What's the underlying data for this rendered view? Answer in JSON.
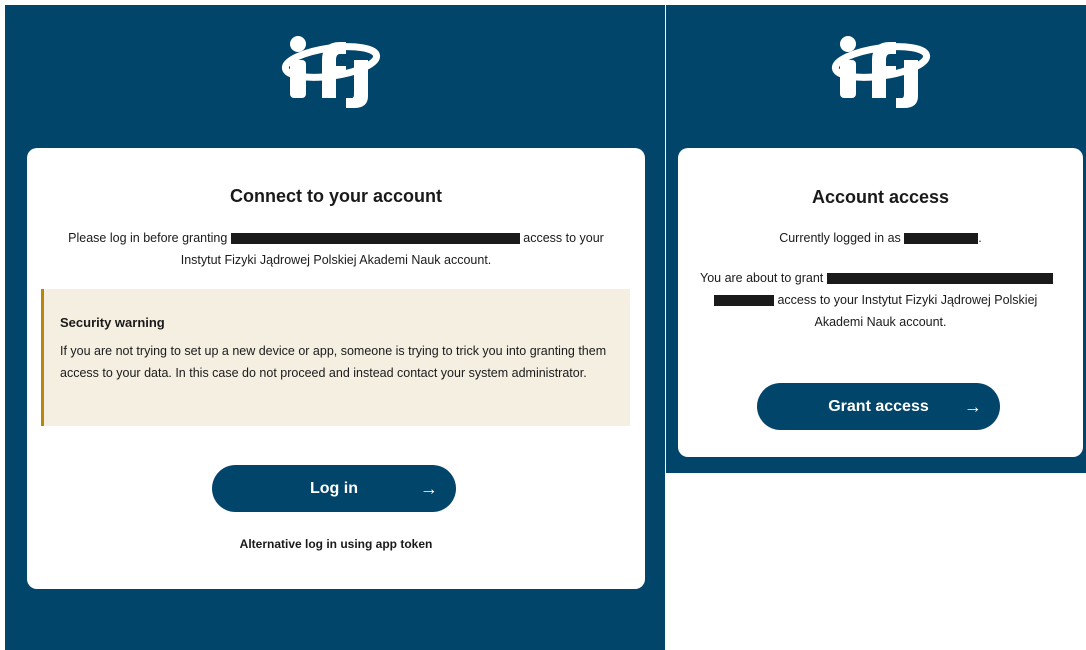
{
  "login": {
    "title": "Connect to your account",
    "intro_before": "Please log in before granting",
    "intro_after": "access to your",
    "intro_line2": "Instytut Fizyki Jądrowej Polskiej Akademi Nauk account.",
    "warning": {
      "title": "Security warning",
      "text": "If you are not trying to set up a new device or app, someone is trying to trick you into granting them access to your data. In this case do not proceed and instead contact your system administrator."
    },
    "login_button": "Log in",
    "alt_login": "Alternative log in using app token"
  },
  "grant": {
    "title": "Account access",
    "logged_in_prefix": "Currently logged in as",
    "logged_in_suffix": ".",
    "about_prefix": "You are about to grant",
    "about_after": "access to your Instytut Fizyki Jądrowej Polskiej",
    "about_line3": "Akademi Nauk account.",
    "grant_button": "Grant access"
  },
  "icons": {
    "arrow": "→",
    "logo": "ifj-logo-icon"
  },
  "colors": {
    "brand": "#02456b",
    "warning_bg": "#f5efe2",
    "warning_border": "#b8860b"
  }
}
